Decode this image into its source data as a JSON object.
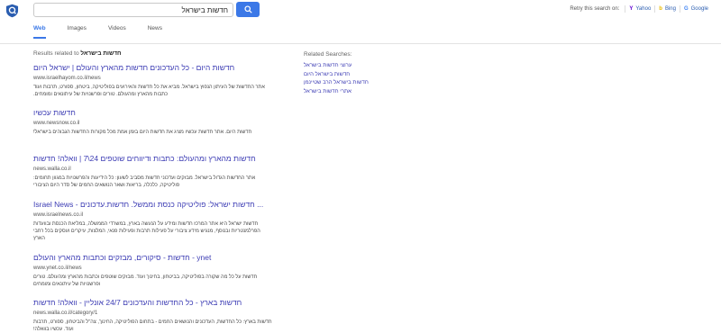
{
  "search": {
    "query": "חדשות בישראל"
  },
  "retry": {
    "label": "Retry this search on:",
    "engines": [
      {
        "name": "Yahoo",
        "glyph": "Y",
        "color": "#6001d2",
        "icon": "yahoo-icon"
      },
      {
        "name": "Bing",
        "glyph": "b",
        "color": "#e8b900",
        "icon": "bing-icon"
      },
      {
        "name": "Google",
        "glyph": "G",
        "color": "#4285f4",
        "icon": "google-icon"
      }
    ]
  },
  "tabs": [
    {
      "label": "Web",
      "active": true
    },
    {
      "label": "Images",
      "active": false
    },
    {
      "label": "Videos",
      "active": false
    },
    {
      "label": "News",
      "active": false
    }
  ],
  "results_related": {
    "prefix": "Results related to",
    "query": "חדשות בישראל"
  },
  "results": [
    {
      "title": "חדשות היום - כל העדכונים חדשות מהארץ והעולם | ישראל היום",
      "url": "www.israelhayom.co.il/news",
      "snippet": "אתר החדשות של העיתון הנפוץ בישראל. מביא את כל חדשות והאירועים בפוליטיקה, ביטחון, ספורט, תרבות ועוד כתבות מהארץ ומהעולם. טורים ופרשנויות של עיתונאים ומומחים."
    },
    {
      "title": "חדשות עכשיו",
      "url": "www.newsnow.co.il",
      "snippet": "חדשות היום. אתר חדשות עכשיו מציג את חדשות היום בזמן אמת מכל מקורות החדשות הגבוהים בישראל!"
    },
    {
      "title": "חדשות מהארץ ומהעולם: כתבות ודיווחים שוטפים 24\\7 | וואלה! חדשות",
      "url": "news.walla.co.il",
      "snippet": "אתר החדשות הגדול בישראל. מבזקים ועדכוני חדשות מסביב לשעון: כל הידיעות והפרשנויות במגוון תחומים: פוליטיקה, כלכלה, בריאות ושאר הנושאים החמים של סדר היום הציבורי"
    },
    {
      "title": "... חדשות ישראל: פוליטיקה כנסת וממשל. חדשות.עדכונים - Israel News",
      "url": "www.israelnews.co.il",
      "snippet": "חדשות ישראל היא אתר המרכז חדשות ומידע על הנעשה בארץ, במשרדי הממשלה, במליאת הכנסת ובוועדות הפרלמנטריות ובנוסף, מנגיש מידע ציבורי על פעילות תרבות ופעילות פנאי, המלצות, עיקרים ועסקים בכל רחבי הארץ"
    },
    {
      "title": "ynet - חדשות - סיקורים, מבזקים וכתבות מהארץ והעולם",
      "url": "www.ynet.co.il/news",
      "snippet": "חדשות על כל מה שקורה בפוליטיקה, בביטחון, בחינוך ועוד. מבזקים שוטפים וכתבות מהארץ ומהעולם. טורים ופרשנויות של עיתונאים ומומחים"
    },
    {
      "title": "חדשות בארץ - כל החדשות והעדכונים 24/7 אונליין - וואלה! חדשות",
      "url": "news.walla.co.il/category/1",
      "snippet": "חדשות בארץ: כל החדשות, העדכונים והנושאים החמים - בתחום הפוליטיקה, החינוך, צה\"ל והביטחון, ספורט, תרבות ועוד. עכשיו בוואלה!"
    }
  ],
  "related_searches": {
    "heading": "Related Searches:",
    "items": [
      "ערוצי חדשות בישראל",
      "חדשות בישראל היום",
      "חדשות בישראל הרב שטיינמן",
      "אתרי חדשות בישראל"
    ]
  }
}
